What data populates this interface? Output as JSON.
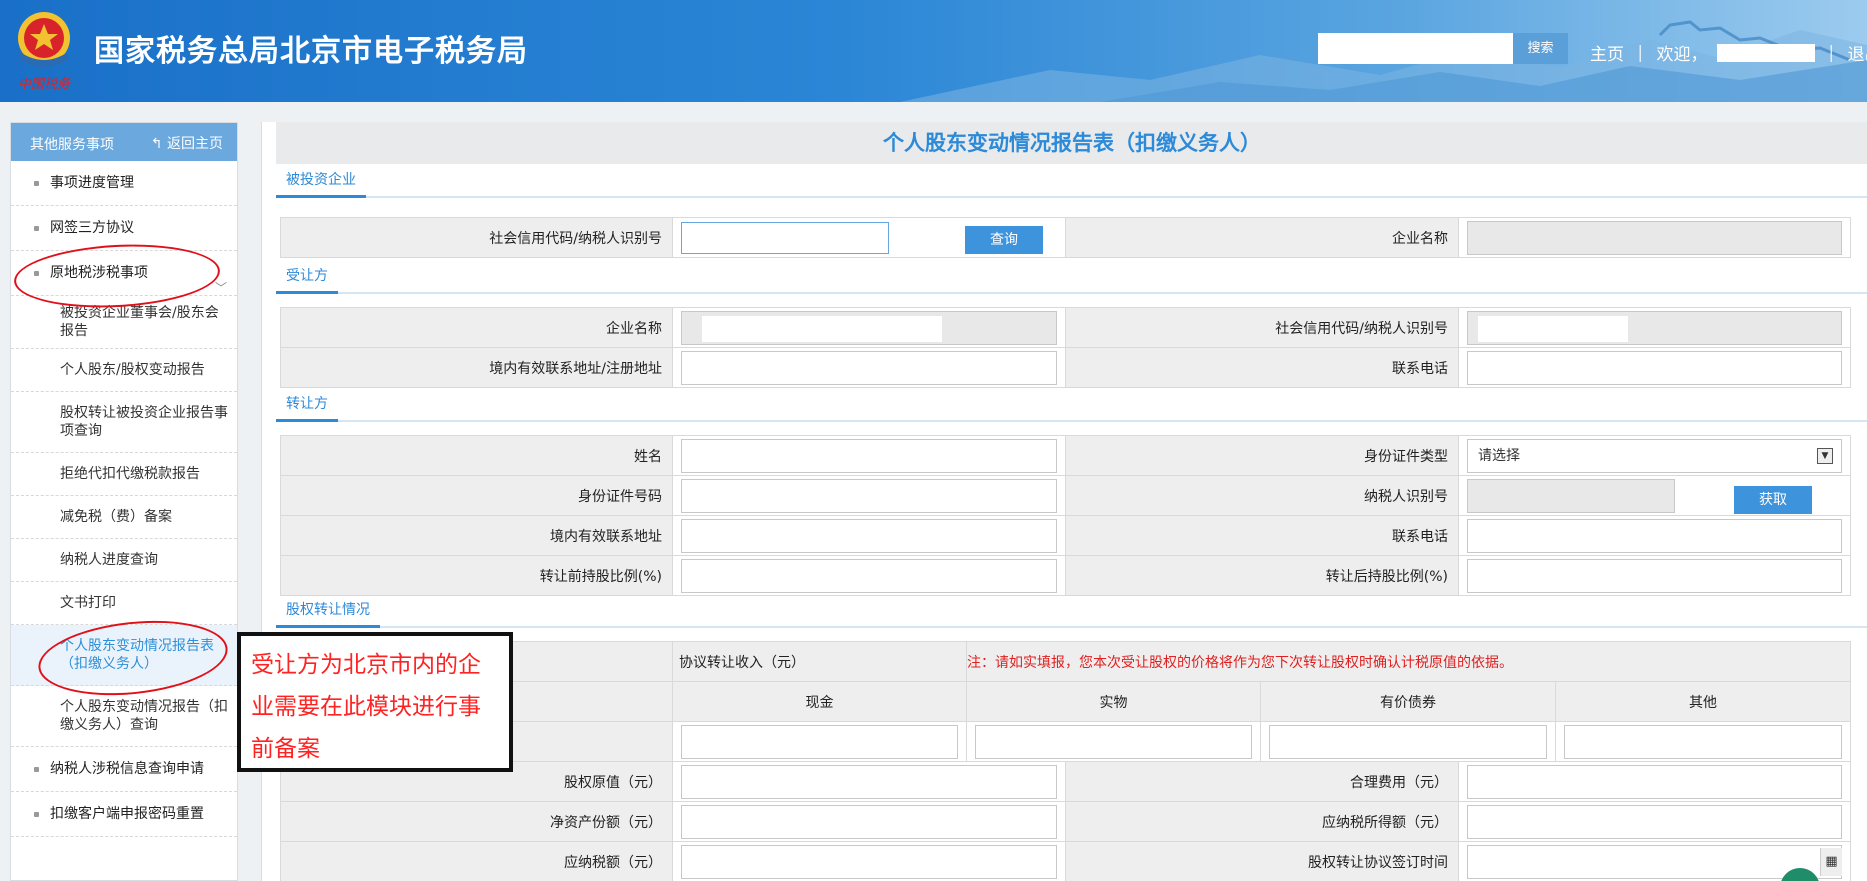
{
  "header": {
    "title": "国家税务总局北京市电子税务局",
    "logo_text": "中国税务",
    "search_placeholder": "",
    "search_label": "搜索",
    "nav_home": "主页",
    "nav_welcome": "欢迎，",
    "nav_logout": "退出",
    "sep": "|"
  },
  "sidebar": {
    "head_title": "其他服务事项",
    "back_label": "返回主页",
    "items": [
      {
        "label": "事项进度管理"
      },
      {
        "label": "网签三方协议"
      },
      {
        "label": "原地税涉税事项"
      },
      {
        "label": "被投资企业董事会/股东会报告"
      },
      {
        "label": "个人股东/股权变动报告"
      },
      {
        "label": "股权转让被投资企业报告事项查询"
      },
      {
        "label": "拒绝代扣代缴税款报告"
      },
      {
        "label": "减免税（费）备案"
      },
      {
        "label": "纳税人进度查询"
      },
      {
        "label": "文书打印"
      },
      {
        "label": "个人股东变动情况报告表（扣缴义务人）"
      },
      {
        "label": "个人股东变动情况报告（扣缴义务人）查询"
      },
      {
        "label": "纳税人涉税信息查询申请"
      },
      {
        "label": "扣缴客户端申报密码重置"
      }
    ]
  },
  "form": {
    "title": "个人股东变动情况报告表（扣缴义务人）",
    "sections": {
      "invested": "被投资企业",
      "transferee": "受让方",
      "transferor": "转让方",
      "equity": "股权转让情况"
    },
    "invested": {
      "credit_code_label": "社会信用代码/纳税人识别号",
      "query_btn": "查询",
      "company_name_label": "企业名称"
    },
    "transferee": {
      "company_name_label": "企业名称",
      "credit_code_label": "社会信用代码/纳税人识别号",
      "address_label": "境内有效联系地址/注册地址",
      "phone_label": "联系电话"
    },
    "transferor": {
      "name_label": "姓名",
      "id_type_label": "身份证件类型",
      "id_type_value": "请选择",
      "id_no_label": "身份证件号码",
      "taxpayer_id_label": "纳税人识别号",
      "get_btn": "获取",
      "address_label": "境内有效联系地址",
      "phone_label": "联系电话",
      "before_ratio_label": "转让前持股比例(%)",
      "after_ratio_label": "转让后持股比例(%)"
    },
    "equity": {
      "income_label": "协议转让收入（元）",
      "note": "注：请如实填报，您本次受让股权的价格将作为您下次转让股权时确认计税原值的依据。",
      "cols": [
        "现金",
        "实物",
        "有价债券",
        "其他"
      ],
      "original_value_label": "股权原值（元）",
      "reasonable_cost_label": "合理费用（元）",
      "net_asset_label": "净资产份额（元）",
      "taxable_income_label": "应纳税所得额（元）",
      "tax_payable_label": "应纳税额（元）",
      "sign_date_label": "股权转让协议签订时间"
    }
  },
  "annotation": {
    "text": "受让方为北京市内的企业需要在此模块进行事前备案"
  }
}
